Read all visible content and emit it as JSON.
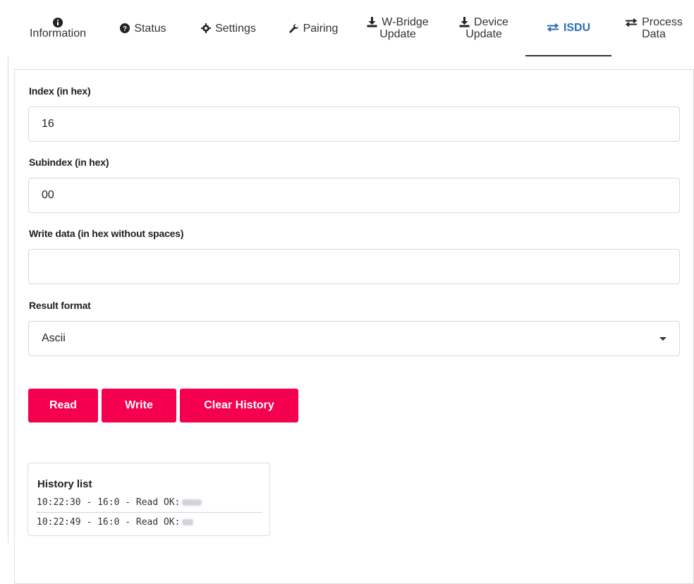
{
  "tabs": [
    {
      "id": "information",
      "label": "Information",
      "icon": "info-circle-icon"
    },
    {
      "id": "status",
      "label": "Status",
      "icon": "question-circle-icon"
    },
    {
      "id": "settings",
      "label": "Settings",
      "icon": "gear-icon"
    },
    {
      "id": "pairing",
      "label": "Pairing",
      "icon": "wrench-icon"
    },
    {
      "id": "wbridge-update",
      "label_line1": "W-Bridge",
      "label_line2": "Update",
      "icon": "download-icon"
    },
    {
      "id": "device-update",
      "label_line1": "Device",
      "label_line2": "Update",
      "icon": "download-icon"
    },
    {
      "id": "isdu",
      "label": "ISDU",
      "icon": "exchange-icon",
      "active": true
    },
    {
      "id": "process-data",
      "label_line1": "Process",
      "label_line2": "Data",
      "icon": "exchange-icon"
    }
  ],
  "form": {
    "index": {
      "label": "Index (in hex)",
      "value": "16"
    },
    "subindex": {
      "label": "Subindex (in hex)",
      "value": "00"
    },
    "write_data": {
      "label": "Write data (in hex without spaces)",
      "value": ""
    },
    "result_format": {
      "label": "Result format",
      "value": "Ascii"
    }
  },
  "buttons": {
    "read": "Read",
    "write": "Write",
    "clear": "Clear History"
  },
  "history": {
    "title": "History list",
    "entries": [
      {
        "text": "10:22:30 - 16:0 - Read OK:"
      },
      {
        "text": "10:22:49 - 16:0 - Read OK:"
      }
    ]
  },
  "colors": {
    "accent": "#f4004f",
    "active_tab": "#2d6fb6"
  }
}
